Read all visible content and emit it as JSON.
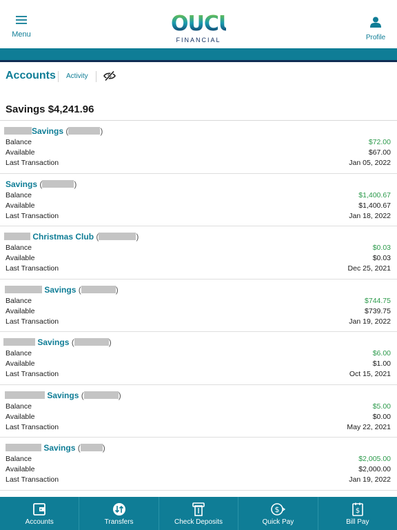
{
  "header": {
    "menu_label": "Menu",
    "profile_label": "Profile",
    "logo_text": "OUCU",
    "logo_sub": "FINANCIAL"
  },
  "tabs": {
    "accounts": "Accounts",
    "activity": "Activity"
  },
  "section": {
    "title": "Savings $4,241.96"
  },
  "labels": {
    "balance": "Balance",
    "available": "Available",
    "last_transaction": "Last Transaction"
  },
  "accounts": [
    {
      "name": "Savings",
      "balance": "$72.00",
      "available": "$67.00",
      "last_transaction": "Jan 05, 2022"
    },
    {
      "name": "Savings",
      "balance": "$1,400.67",
      "available": "$1,400.67",
      "last_transaction": "Jan 18, 2022"
    },
    {
      "name": "Christmas Club",
      "balance": "$0.03",
      "available": "$0.03",
      "last_transaction": "Dec 25, 2021"
    },
    {
      "name": "Savings",
      "balance": "$744.75",
      "available": "$739.75",
      "last_transaction": "Jan 19, 2022"
    },
    {
      "name": "Savings",
      "balance": "$6.00",
      "available": "$1.00",
      "last_transaction": "Oct 15, 2021"
    },
    {
      "name": "Savings",
      "balance": "$5.00",
      "available": "$0.00",
      "last_transaction": "May 22, 2021"
    },
    {
      "name": "Savings",
      "balance": "$2,005.00",
      "available": "$2,000.00",
      "last_transaction": "Jan 19, 2022"
    }
  ],
  "bottom_nav": {
    "accounts": "Accounts",
    "transfers": "Transfers",
    "check_deposits": "Check Deposits",
    "quick_pay": "Quick Pay",
    "bill_pay": "Bill Pay"
  },
  "colors": {
    "brand_teal": "#0f7d96",
    "brand_navy": "#102d54",
    "positive_green": "#2c9a4b"
  },
  "icons": [
    "hamburger-menu-icon",
    "profile-icon",
    "eye-off-icon",
    "wallet-icon",
    "transfer-icon",
    "check-deposit-icon",
    "quick-pay-icon",
    "bill-pay-icon"
  ]
}
